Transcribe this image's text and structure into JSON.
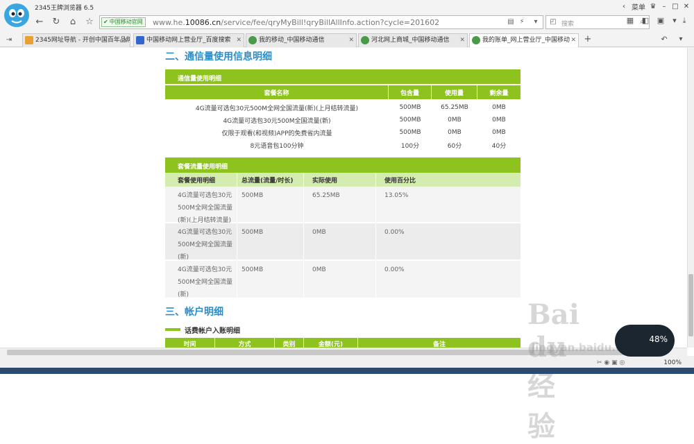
{
  "browser": {
    "app_title": "2345王牌浏览器 6.5",
    "menu_label": "菜单",
    "address": {
      "badge": "中国移动官网",
      "url_prefix": "www.he.",
      "url_domain": "10086.cn",
      "url_path": "/service/fee/qryMyBill!qryBillAllInfo.action?cycle=201602"
    },
    "search_placeholder": "搜索",
    "zoom": "100%"
  },
  "tabs": [
    {
      "label": "2345网址导航 - 开创中国百年品牌",
      "icon": "orange"
    },
    {
      "label": "中国移动网上营业厅_百度搜索",
      "icon": "blue"
    },
    {
      "label": "我的移动_中国移动通信",
      "icon": "green"
    },
    {
      "label": "河北网上商城_中国移动通信",
      "icon": "green"
    },
    {
      "label": "我的账单_网上营业厅_中国移动",
      "icon": "green",
      "active": true
    }
  ],
  "page": {
    "section2_title": "二、通信量使用信息明细",
    "usage_table": {
      "title": "通信量使用明细",
      "headers": [
        "套餐名称",
        "包含量",
        "使用量",
        "剩余量"
      ],
      "rows": [
        [
          "4G流量可选包30元500M全网全国流量(新)(上月结转流量)",
          "500MB",
          "65.25MB",
          "0MB"
        ],
        [
          "4G流量可选包30元500M全国流量(新)",
          "500MB",
          "0MB",
          "0MB"
        ],
        [
          "仅限于观看(和视频)APP的免费省内流量",
          "500MB",
          "0MB",
          "0MB"
        ],
        [
          "8元语音包100分钟",
          "100分",
          "60分",
          "40分"
        ]
      ]
    },
    "data_table": {
      "title": "套餐流量使用明细",
      "headers": [
        "套餐使用明细",
        "总流量(流量/时长)",
        "实际使用",
        "使用百分比"
      ],
      "rows": [
        {
          "name": [
            "4G流量可选包30元",
            "500M全网全国流量",
            "(新)(上月结转流量)"
          ],
          "total": "500MB",
          "used": "65.25MB",
          "pct": "13.05%"
        },
        {
          "name": [
            "4G流量可选包30元",
            "500M全网全国流量",
            "(新)"
          ],
          "total": "500MB",
          "used": "0MB",
          "pct": "0.00%"
        },
        {
          "name": [
            "4G流量可选包30元",
            "500M全网全国流量",
            "(新)"
          ],
          "total": "500MB",
          "used": "0MB",
          "pct": "0.00%"
        }
      ]
    },
    "section3_title": "三、帐户明细",
    "account_sub": "话费帐户入账明细",
    "account_headers": [
      "时间",
      "方式",
      "类别",
      "金额(元)",
      "备注"
    ]
  },
  "overlay": {
    "gauge_value": "48%",
    "watermark_brand": "Bai du 经验",
    "watermark_url": "jingyan.baidu.com"
  }
}
